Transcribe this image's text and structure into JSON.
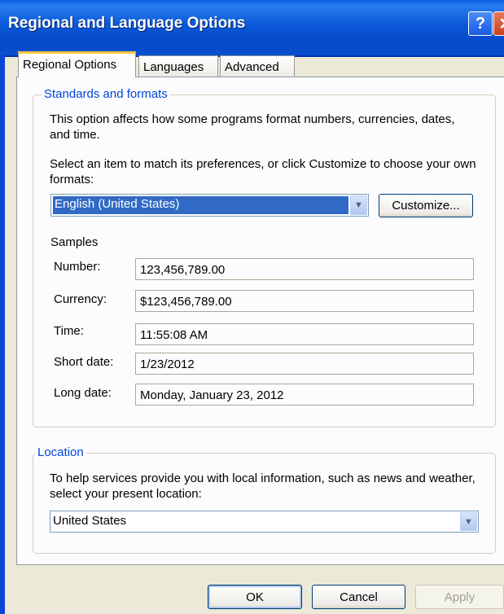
{
  "window": {
    "title": "Regional and Language Options",
    "help_glyph": "?",
    "close_glyph": "✕"
  },
  "tabs": [
    {
      "label": "Regional Options",
      "active": true
    },
    {
      "label": "Languages",
      "active": false
    },
    {
      "label": "Advanced",
      "active": false
    }
  ],
  "standards": {
    "legend": "Standards and formats",
    "description": "This option affects how some programs format numbers, currencies, dates, and time.",
    "instruction": "Select an item to match its preferences, or click Customize to choose your own formats:",
    "selected_format": "English (United States)",
    "customize_label": "Customize...",
    "samples_heading": "Samples",
    "samples": [
      {
        "label": "Number:",
        "value": "123,456,789.00"
      },
      {
        "label": "Currency:",
        "value": "$123,456,789.00"
      },
      {
        "label": "Time:",
        "value": "11:55:08 AM"
      },
      {
        "label": "Short date:",
        "value": "1/23/2012"
      },
      {
        "label": "Long date:",
        "value": "Monday, January 23, 2012"
      }
    ]
  },
  "location": {
    "legend": "Location",
    "description": "To help services provide you with local information, such as news and weather, select your present location:",
    "selected": "United States"
  },
  "footer": {
    "ok_label": "OK",
    "cancel_label": "Cancel",
    "apply_label": "Apply"
  },
  "icons": {
    "dropdown_arrow": "▼"
  },
  "colors": {
    "title_bar": "#0a58d8",
    "legend_text": "#0046d5",
    "selection": "#316ac5",
    "active_tab_highlight": "#ffc83c"
  }
}
